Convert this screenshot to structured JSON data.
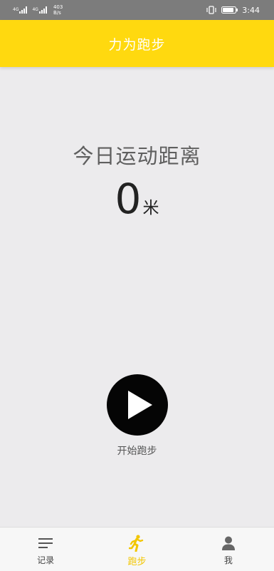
{
  "status_bar": {
    "net_1": "4G",
    "net_2": "4G",
    "speed_value": "403",
    "speed_unit": "B/s",
    "time": "3:44"
  },
  "app_bar": {
    "title": "力为跑步"
  },
  "main": {
    "distance_label": "今日运动距离",
    "distance_value": "0",
    "distance_unit": "米",
    "start_label": "开始跑步"
  },
  "bottom_nav": {
    "items": [
      {
        "label": "记录",
        "icon": "list-icon",
        "active": false
      },
      {
        "label": "跑步",
        "icon": "runner-icon",
        "active": true
      },
      {
        "label": "我",
        "icon": "person-icon",
        "active": false
      }
    ]
  },
  "colors": {
    "accent": "#ffd90f",
    "active_tab": "#f2c600",
    "background": "#ecebed",
    "status_bar": "#7c7c7c"
  }
}
